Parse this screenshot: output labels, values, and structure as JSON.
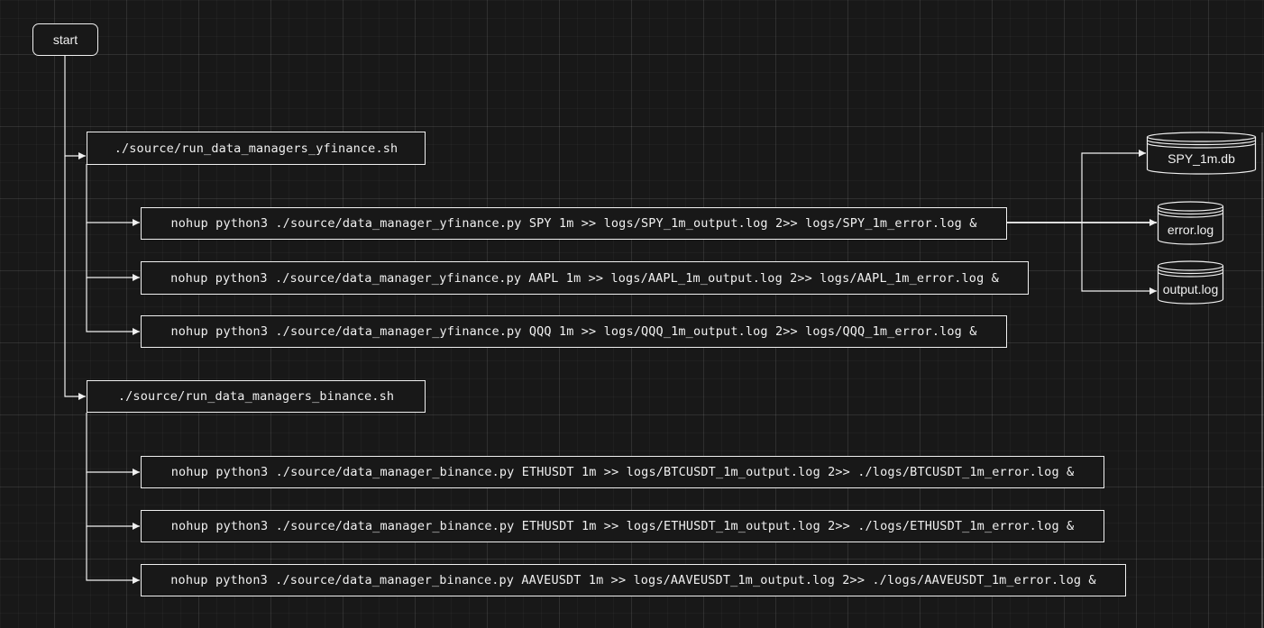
{
  "nodes": {
    "start": "start",
    "yfinance_script": "./source/run_data_managers_yfinance.sh",
    "cmd_spy": "nohup python3 ./source/data_manager_yfinance.py SPY 1m >> logs/SPY_1m_output.log 2>> logs/SPY_1m_error.log &",
    "cmd_aapl": "nohup python3 ./source/data_manager_yfinance.py AAPL 1m >> logs/AAPL_1m_output.log 2>> logs/AAPL_1m_error.log &",
    "cmd_qqq": "nohup python3 ./source/data_manager_yfinance.py QQQ 1m >> logs/QQQ_1m_output.log 2>> logs/QQQ_1m_error.log &",
    "binance_script": "./source/run_data_managers_binance.sh",
    "cmd_btcusdt": "nohup python3 ./source/data_manager_binance.py ETHUSDT 1m >> logs/BTCUSDT_1m_output.log 2>> ./logs/BTCUSDT_1m_error.log &",
    "cmd_ethusdt": "nohup python3 ./source/data_manager_binance.py ETHUSDT 1m >> logs/ETHUSDT_1m_output.log 2>> ./logs/ETHUSDT_1m_error.log &",
    "cmd_aaveusdt": "nohup python3 ./source/data_manager_binance.py AAVEUSDT 1m >> logs/AAVEUSDT_1m_output.log 2>> ./logs/AAVEUSDT_1m_error.log &"
  },
  "storage": {
    "spy_db": "SPY_1m.db",
    "error_log": "error.log",
    "output_log": "output.log"
  },
  "colors": {
    "background": "#181818",
    "stroke": "#f0f0f0"
  }
}
